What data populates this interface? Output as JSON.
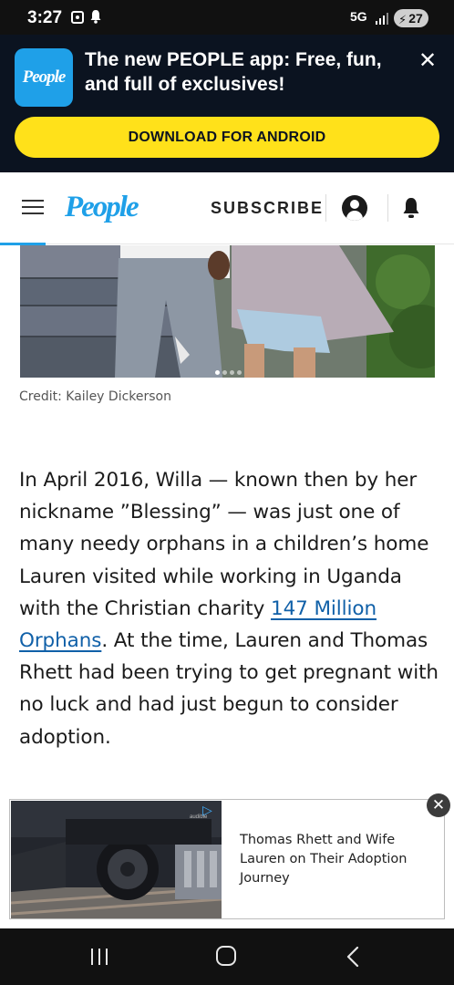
{
  "status_bar": {
    "time": "3:27",
    "network": "5G",
    "battery": "27",
    "icons": [
      "media-icon",
      "notification-bell-icon",
      "signal-icon",
      "battery-icon"
    ]
  },
  "app_banner": {
    "logo_text": "People",
    "title": "The new PEOPLE app: Free, fun, and full of exclusives!",
    "download_label": "DOWNLOAD FOR ANDROID",
    "close_icon": "close-icon"
  },
  "header": {
    "logo_text": "People",
    "subscribe_label": "SUBSCRIBE",
    "icons": [
      "hamburger-menu-icon",
      "account-icon",
      "notification-bell-icon"
    ]
  },
  "hero": {
    "credit": "Credit: Kailey Dickerson",
    "slide_count": 4,
    "active_slide": 1
  },
  "article": {
    "before_link": "In April 2016, Willa — known then by her nickname ”Blessing” — was just one of many needy orphans in a children’s home Lauren visited while working in Uganda with the Christian charity ",
    "link_text": "147 Million Orphans",
    "after_link": ". At the time, Lauren and Thomas Rhett had been trying to get pregnant with no luck and had just begun to consider adoption."
  },
  "ad": {
    "brand": "audible",
    "title": "Thomas Rhett and Wife Lauren on Their Adoption Journey",
    "close_icon": "close-icon"
  },
  "nav_bar": {
    "icons": [
      "recents-icon",
      "home-icon",
      "back-icon"
    ]
  },
  "colors": {
    "brand_blue": "#1fa0e8",
    "banner_bg": "#0b1320",
    "cta_yellow": "#ffe11a",
    "link_blue": "#1060a8"
  }
}
